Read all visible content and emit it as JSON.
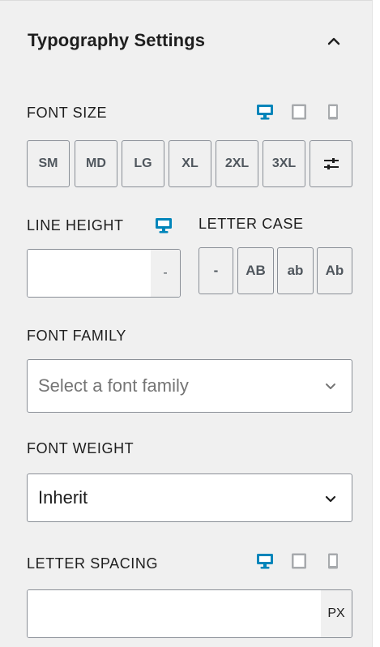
{
  "panel": {
    "title": "Typography Settings",
    "collapse_icon": "chevron-up-icon"
  },
  "font_size": {
    "label": "FONT SIZE",
    "devices": [
      "desktop-icon",
      "tablet-icon",
      "mobile-icon"
    ],
    "active_device": "desktop",
    "sizes": [
      "SM",
      "MD",
      "LG",
      "XL",
      "2XL",
      "3XL"
    ],
    "custom_icon": "sliders-icon"
  },
  "line_height": {
    "label": "LINE HEIGHT",
    "device_icon": "desktop-icon",
    "value": "",
    "unit": "-"
  },
  "letter_case": {
    "label": "LETTER CASE",
    "options": [
      "-",
      "AB",
      "ab",
      "Ab"
    ]
  },
  "font_family": {
    "label": "FONT FAMILY",
    "placeholder": "Select a font family"
  },
  "font_weight": {
    "label": "FONT WEIGHT",
    "value": "Inherit"
  },
  "letter_spacing": {
    "label": "LETTER SPACING",
    "devices": [
      "desktop-icon",
      "tablet-icon",
      "mobile-icon"
    ],
    "active_device": "desktop",
    "value": "",
    "unit": "PX"
  },
  "colors": {
    "accent": "#0085ba",
    "panel_bg": "#f0f0f0",
    "border": "#8a8f97",
    "muted_icon": "#a7aaad"
  }
}
